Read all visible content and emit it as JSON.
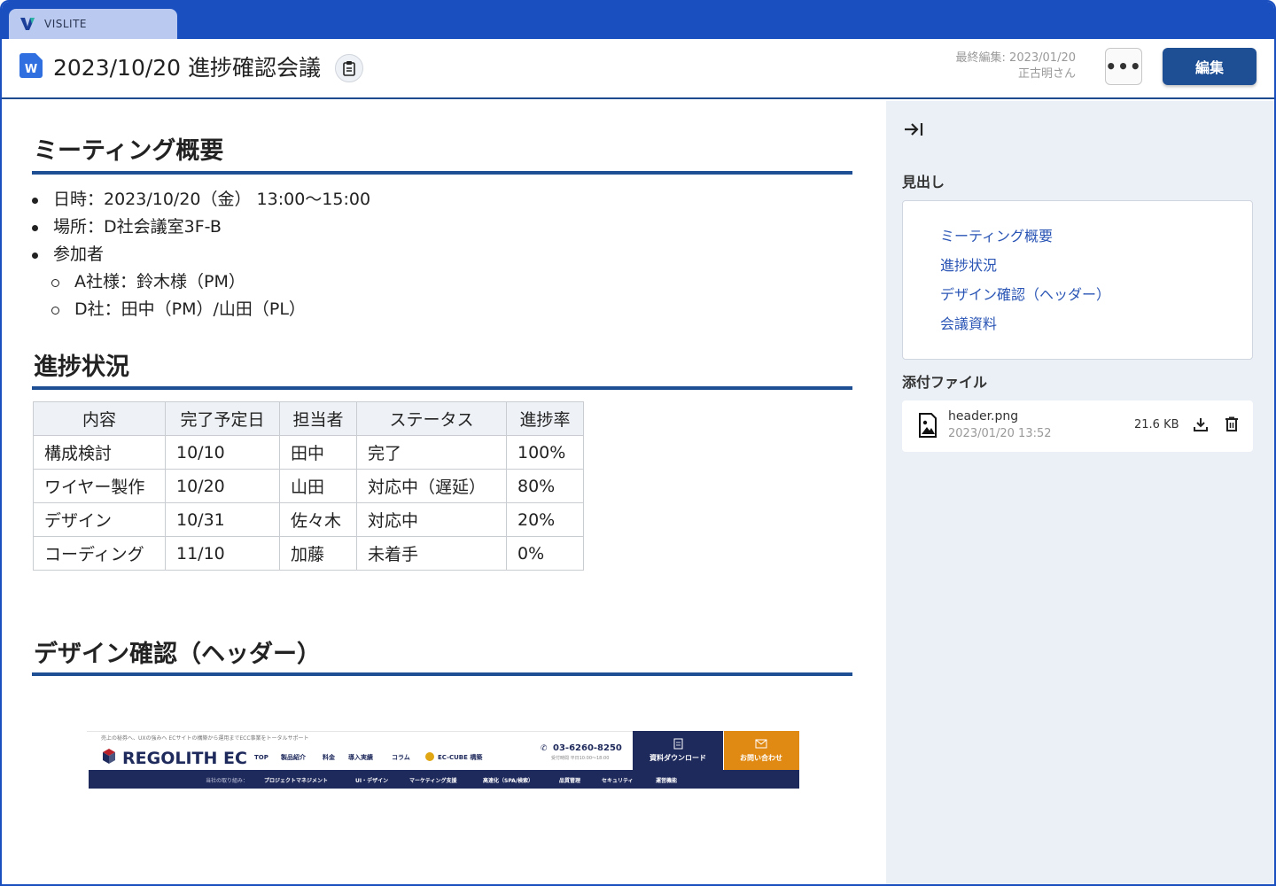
{
  "app": {
    "tab_label": "VISLITE"
  },
  "header": {
    "doc_icon_letter": "W",
    "title": "2023/10/20 進捗確認会議",
    "last_edit_line1": "最終編集: 2023/01/20",
    "last_edit_line2": "正古明さん",
    "more_label": "•••",
    "edit_label": "編集"
  },
  "main": {
    "sections": [
      {
        "heading": "ミーティング概要"
      },
      {
        "heading": "進捗状況"
      },
      {
        "heading": "デザイン確認（ヘッダー）"
      }
    ],
    "overview": [
      {
        "level": 1,
        "text": "日時：2023/10/20（金） 13:00〜15:00"
      },
      {
        "level": 1,
        "text": "場所：D社会議室3F-B"
      },
      {
        "level": 1,
        "text": "参加者"
      },
      {
        "level": 2,
        "text": "A社様：鈴木様（PM）"
      },
      {
        "level": 2,
        "text": "D社：田中（PM）/山田（PL）"
      }
    ],
    "table": {
      "headers": [
        "内容",
        "完了予定日",
        "担当者",
        "ステータス",
        "進捗率"
      ],
      "rows": [
        [
          "構成検討",
          "10/10",
          "田中",
          "完了",
          "100%"
        ],
        [
          "ワイヤー製作",
          "10/20",
          "山田",
          "対応中（遅延）",
          "80%"
        ],
        [
          "デザイン",
          "10/31",
          "佐々木",
          "対応中",
          "20%"
        ],
        [
          "コーディング",
          "11/10",
          "加藤",
          "未着手",
          "0%"
        ]
      ]
    },
    "banner": {
      "top_text": "売上の秘券へ、UXの強みへ ECサイトの構築から運用までECC事業をトータルサポート",
      "brand": "REGOLITH EC",
      "nav": [
        "TOP",
        "製品紹介",
        "料金",
        "導入実績",
        "コラム"
      ],
      "partner": "EC-CUBE 構築",
      "phone": "03-6260-8250",
      "phone_sub": "受付時間 平日10:00〜18:00",
      "download_label": "資料ダウンロード",
      "contact_label": "お問い合わせ",
      "bottom_lead": "当社の取り組み：",
      "bottom_nav": [
        "プロジェクトマネジメント",
        "UI・デザイン",
        "マーケティング支援",
        "高速化（SPA/検索）",
        "品質管理",
        "セキュリティ",
        "運営機能"
      ],
      "colors": {
        "navy": "#1f2a5c",
        "orange": "#e08a14",
        "red": "#b8202a"
      }
    }
  },
  "sidebar": {
    "collapse_icon": "collapse-right-icon",
    "toc_label": "見出し",
    "toc_items": [
      "ミーティング概要",
      "進捗状況",
      "デザイン確認（ヘッダー）",
      "会議資料"
    ],
    "attach_label": "添付ファイル",
    "attachment": {
      "name": "header.png",
      "date": "2023/01/20 13:52",
      "size": "21.6 KB"
    }
  }
}
